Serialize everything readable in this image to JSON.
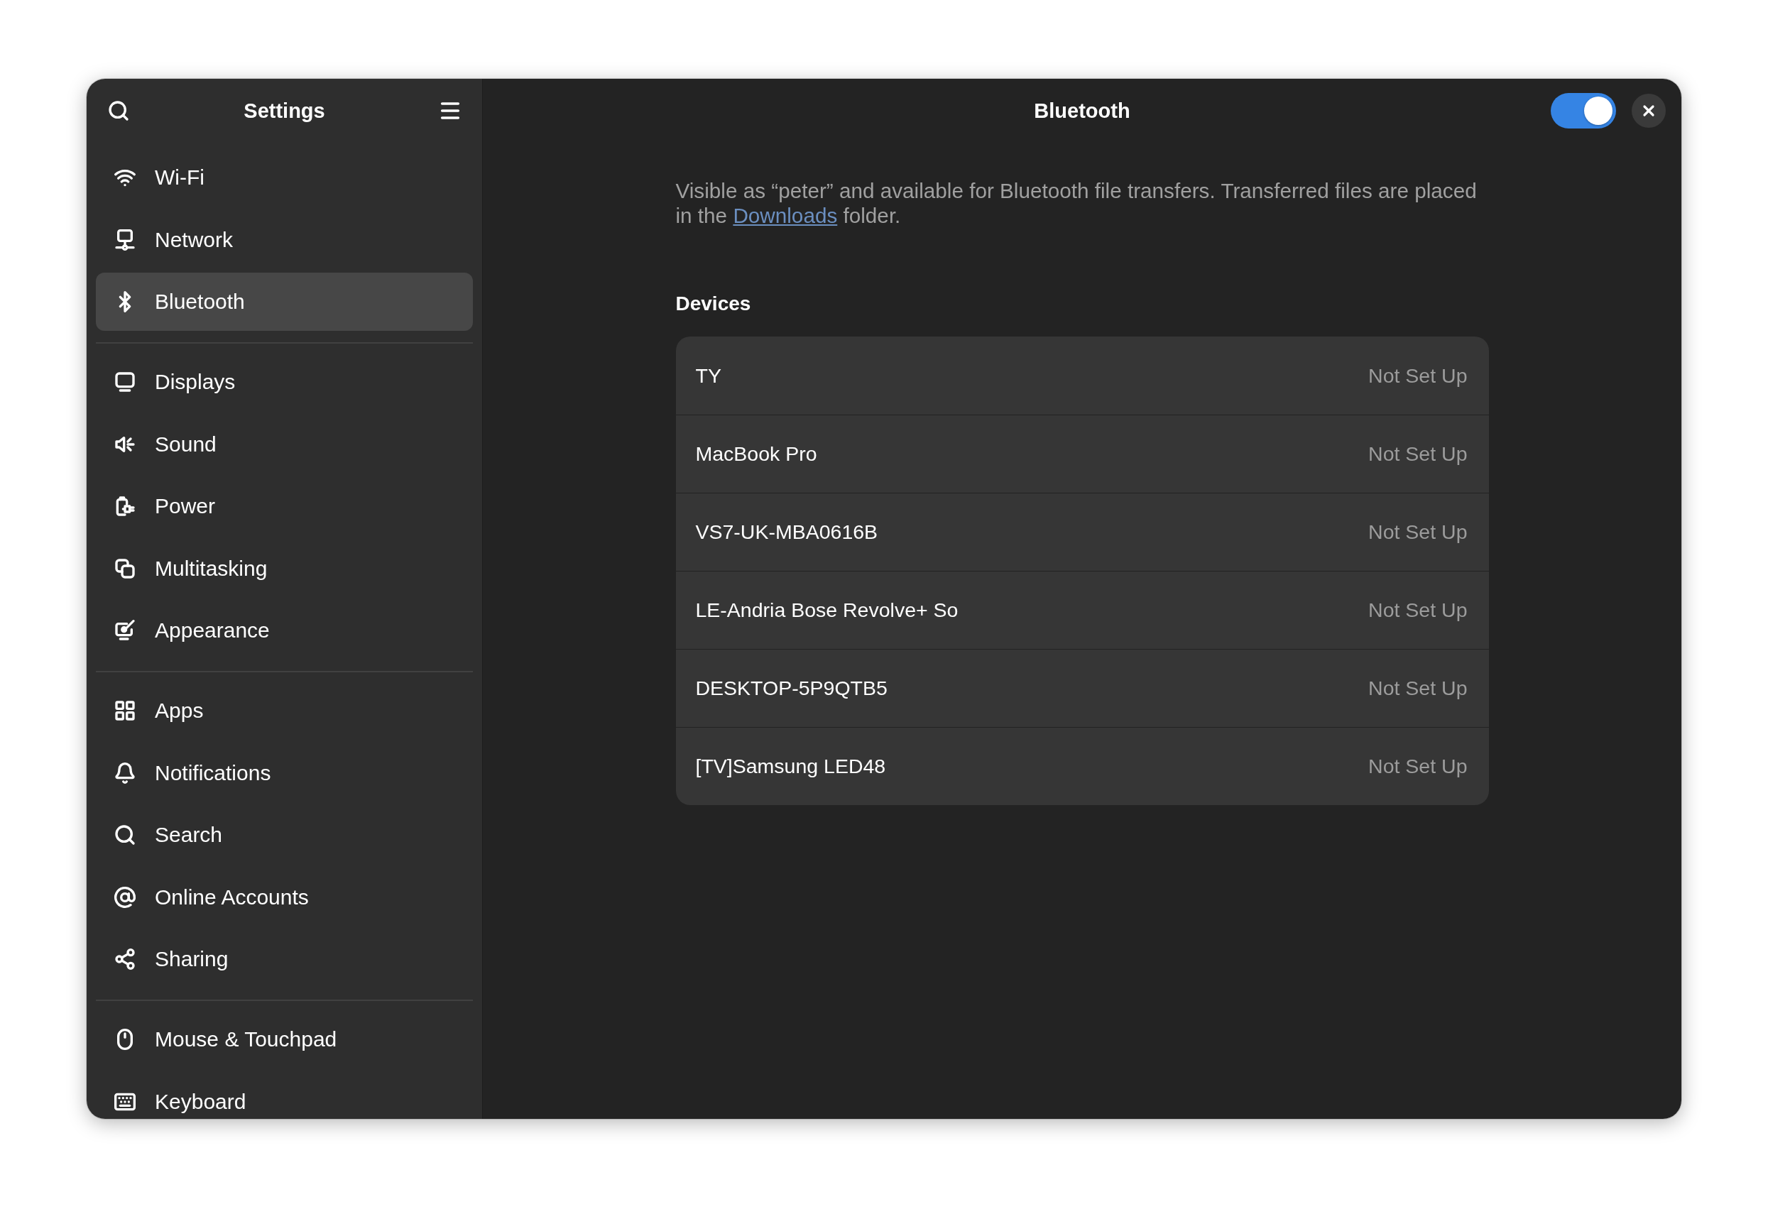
{
  "sidebar": {
    "title": "Settings",
    "sections": [
      {
        "items": [
          {
            "label": "Wi-Fi",
            "selected": false
          },
          {
            "label": "Network",
            "selected": false
          },
          {
            "label": "Bluetooth",
            "selected": true
          }
        ]
      },
      {
        "items": [
          {
            "label": "Displays",
            "selected": false
          },
          {
            "label": "Sound",
            "selected": false
          },
          {
            "label": "Power",
            "selected": false
          },
          {
            "label": "Multitasking",
            "selected": false
          },
          {
            "label": "Appearance",
            "selected": false
          }
        ]
      },
      {
        "items": [
          {
            "label": "Apps",
            "selected": false
          },
          {
            "label": "Notifications",
            "selected": false
          },
          {
            "label": "Search",
            "selected": false
          },
          {
            "label": "Online Accounts",
            "selected": false
          },
          {
            "label": "Sharing",
            "selected": false
          }
        ]
      },
      {
        "items": [
          {
            "label": "Mouse & Touchpad",
            "selected": false
          },
          {
            "label": "Keyboard",
            "selected": false
          }
        ]
      }
    ]
  },
  "header": {
    "title": "Bluetooth",
    "switch": {
      "on": true
    }
  },
  "description": {
    "text": "Visible as “peter” and available for Bluetooth file transfers. Transferred files are placed in the",
    "link": "Downloads",
    "text_after": "folder."
  },
  "devices": {
    "heading": "Devices",
    "items": [
      {
        "name": "TY",
        "status": "Not Set Up"
      },
      {
        "name": "MacBook Pro",
        "status": "Not Set Up"
      },
      {
        "name": "VS7-UK-MBA0616B",
        "status": "Not Set Up"
      },
      {
        "name": "LE-Andria Bose Revolve+ So",
        "status": "Not Set Up"
      },
      {
        "name": "DESKTOP-5P9QTB5",
        "status": "Not Set Up"
      },
      {
        "name": "[TV]Samsung LED48",
        "status": "Not Set Up"
      }
    ]
  }
}
